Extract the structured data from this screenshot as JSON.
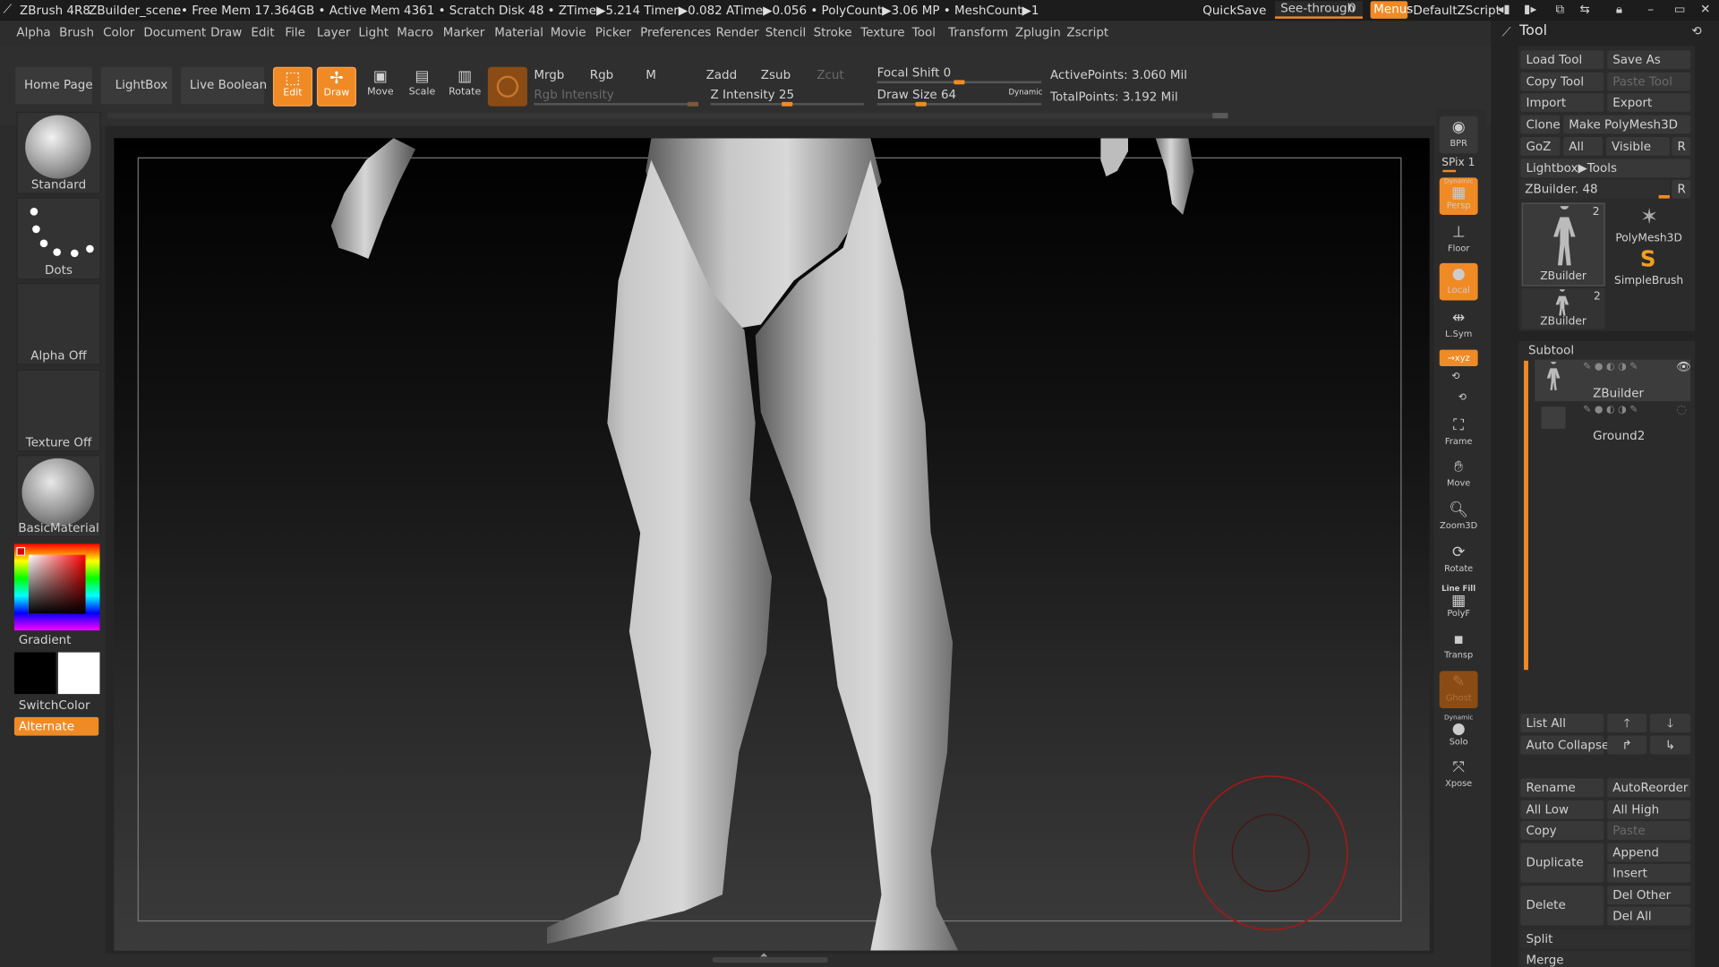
{
  "titlebar": {
    "app": "ZBrush 4R8",
    "scene": "ZBuilder_scene",
    "stats": "..• Free Mem 17.364GB • Active Mem 4361 • Scratch Disk 48 • ZTime▶5.214 Timer▶0.082 ATime▶0.056 • PolyCount▶3.06 MP • MeshCount▶1",
    "quicksave": "QuickSave",
    "seethrough": "See-through",
    "seethrough_value": "0",
    "menus": "Menus",
    "zscript": "DefaultZScript"
  },
  "menubar": {
    "items": [
      "Alpha",
      "Brush",
      "Color",
      "Document",
      "Draw",
      "Edit",
      "File",
      "Layer",
      "Light",
      "Macro",
      "Marker",
      "Material",
      "Movie",
      "Picker",
      "Preferences",
      "Render",
      "Stencil",
      "Stroke",
      "Texture",
      "Tool",
      "Transform",
      "Zplugin",
      "Zscript"
    ]
  },
  "toolbar": {
    "home": "Home Page",
    "lightbox": "LightBox",
    "liveboolean": "Live Boolean",
    "edit": "Edit",
    "draw": "Draw",
    "move": "Move",
    "scale": "Scale",
    "rotate": "Rotate",
    "mrgb": "Mrgb",
    "rgb": "Rgb",
    "m": "M",
    "rgb_intensity": "Rgb Intensity",
    "zadd": "Zadd",
    "zsub": "Zsub",
    "zcut": "Zcut",
    "z_intensity": "Z Intensity 25",
    "focal_shift": "Focal Shift 0",
    "draw_size": "Draw Size 64",
    "dynamic": "Dynamic",
    "active_points": "ActivePoints: 3.060 Mil",
    "total_points": "TotalPoints: 3.192 Mil",
    "z_intensity_value": 25,
    "focal_shift_value": 0,
    "draw_size_value": 64
  },
  "lefttray": {
    "brush": "Standard",
    "stroke": "Dots",
    "alpha": "Alpha Off",
    "texture": "Texture Off",
    "material": "BasicMaterial",
    "gradient": "Gradient",
    "switchcolor": "SwitchColor",
    "alternate": "Alternate"
  },
  "righttray": {
    "bpr": "BPR",
    "spix": "SPix 1",
    "dynamic": "Dynamic",
    "persp": "Persp",
    "floor": "Floor",
    "local": "Local",
    "lsym": "L.Sym",
    "xyz": "→xyz",
    "frame": "Frame",
    "move": "Move",
    "zoom3d": "Zoom3D",
    "rotate": "Rotate",
    "linefill": "Line Fill",
    "polyf": "PolyF",
    "transp": "Transp",
    "ghost": "Ghost",
    "dynamic2": "Dynamic",
    "solo": "Solo",
    "xpose": "Xpose"
  },
  "toolpanel": {
    "title": "Tool",
    "load_tool": "Load Tool",
    "save_as": "Save As",
    "copy_tool": "Copy Tool",
    "paste_tool": "Paste Tool",
    "import": "Import",
    "export": "Export",
    "clone": "Clone",
    "make_polymesh": "Make PolyMesh3D",
    "goz": "GoZ",
    "all": "All",
    "visible": "Visible",
    "r": "R",
    "lightbox_tools": "Lightbox▶Tools",
    "zbuilder_slider": "ZBuilder. 48",
    "tool_thumbs": [
      {
        "name": "ZBuilder",
        "count": "2"
      },
      {
        "name": "PolyMesh3D",
        "count": ""
      },
      {
        "name": "SimpleBrush",
        "count": ""
      },
      {
        "name": "ZBuilder",
        "count": "2"
      }
    ],
    "subtool_title": "Subtool",
    "subtools": [
      "ZBuilder",
      "Ground2"
    ],
    "list_all": "List All",
    "auto_collapse": "Auto Collapse",
    "rename": "Rename",
    "autoreorder": "AutoReorder",
    "all_low": "All Low",
    "all_high": "All High",
    "copy": "Copy",
    "paste": "Paste",
    "duplicate": "Duplicate",
    "append": "Append",
    "insert": "Insert",
    "delete": "Delete",
    "del_other": "Del Other",
    "del_all": "Del All",
    "split": "Split",
    "merge": "Merge"
  },
  "colors": {
    "accent": "#f08a25",
    "background": "#2c2c2c",
    "panel": "#232323"
  }
}
